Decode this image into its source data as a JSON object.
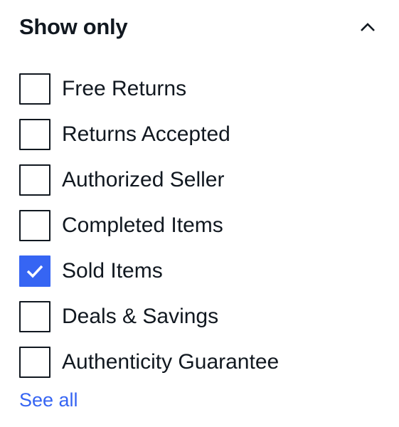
{
  "section": {
    "title": "Show only",
    "collapse_icon": "chevron-up-icon",
    "options": [
      {
        "label": "Free Returns",
        "checked": false
      },
      {
        "label": "Returns Accepted",
        "checked": false
      },
      {
        "label": "Authorized Seller",
        "checked": false
      },
      {
        "label": "Completed Items",
        "checked": false
      },
      {
        "label": "Sold Items",
        "checked": true
      },
      {
        "label": "Deals & Savings",
        "checked": false
      },
      {
        "label": "Authenticity Guarantee",
        "checked": false
      }
    ],
    "see_all_label": "See all"
  },
  "colors": {
    "accent": "#3665f3",
    "text": "#111820"
  }
}
